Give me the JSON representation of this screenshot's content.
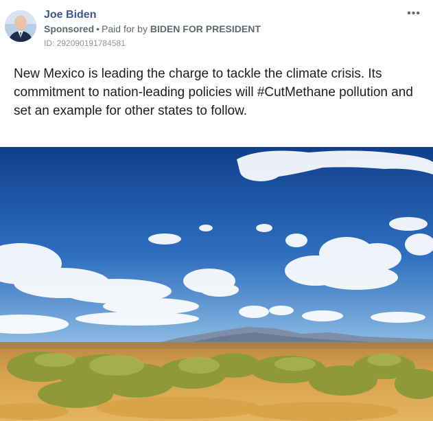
{
  "post": {
    "author": "Joe Biden",
    "sponsored_label": "Sponsored",
    "paid_for_prefix": "Paid for by",
    "payer": "BIDEN FOR PRESIDENT",
    "ad_id": "ID: 292090191784581",
    "more_icon": "more-options-icon",
    "text": "New Mexico is leading the charge to tackle the climate crisis. Its commitment to nation-leading policies will #CutMethane pollution and set an example for other states to follow."
  },
  "colors": {
    "author_link": "#385898",
    "meta_text": "#606770",
    "sky_top": "#0f3f8c",
    "sky_bottom": "#6fa6d8",
    "desert_ground": "#d8a24a"
  }
}
